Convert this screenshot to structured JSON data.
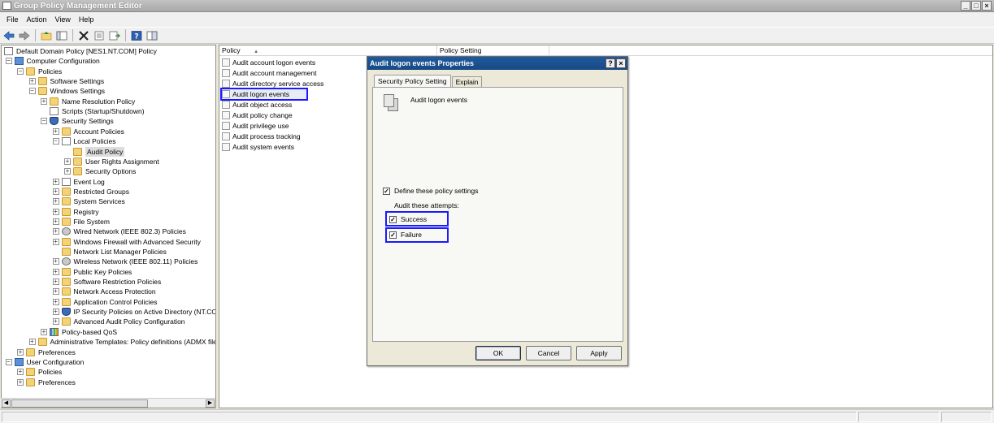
{
  "window": {
    "title": "Group Policy Management Editor",
    "controls": [
      "_",
      "□",
      "×"
    ]
  },
  "menu": [
    "File",
    "Action",
    "View",
    "Help"
  ],
  "tree": [
    {
      "label": "Default Domain Policy [NES1.NT.COM] Policy",
      "icon": "doc-icon",
      "expander": "",
      "indent": 0
    },
    {
      "label": "Computer Configuration",
      "icon": "computer-icon",
      "expander": "−",
      "indent": 1
    },
    {
      "label": "Policies",
      "icon": "folder-icon",
      "expander": "−",
      "indent": 2
    },
    {
      "label": "Software Settings",
      "icon": "folder-icon",
      "expander": "+",
      "indent": 3
    },
    {
      "label": "Windows Settings",
      "icon": "folder-icon",
      "expander": "−",
      "indent": 3
    },
    {
      "label": "Name Resolution Policy",
      "icon": "folder-icon",
      "expander": "+",
      "indent": 4
    },
    {
      "label": "Scripts (Startup/Shutdown)",
      "icon": "doc-icon",
      "expander": "",
      "indent": 4
    },
    {
      "label": "Security Settings",
      "icon": "shield-icon",
      "expander": "−",
      "indent": 4
    },
    {
      "label": "Account Policies",
      "icon": "folder-icon",
      "expander": "+",
      "indent": 5
    },
    {
      "label": "Local Policies",
      "icon": "doc-icon",
      "expander": "−",
      "indent": 5
    },
    {
      "label": "Audit Policy",
      "icon": "folder-icon",
      "expander": "",
      "indent": 6,
      "selected": true
    },
    {
      "label": "User Rights Assignment",
      "icon": "folder-icon",
      "expander": "+",
      "indent": 6
    },
    {
      "label": "Security Options",
      "icon": "folder-icon",
      "expander": "+",
      "indent": 6
    },
    {
      "label": "Event Log",
      "icon": "doc-icon",
      "expander": "+",
      "indent": 5
    },
    {
      "label": "Restricted Groups",
      "icon": "folder-icon",
      "expander": "+",
      "indent": 5
    },
    {
      "label": "System Services",
      "icon": "folder-icon",
      "expander": "+",
      "indent": 5
    },
    {
      "label": "Registry",
      "icon": "folder-icon",
      "expander": "+",
      "indent": 5
    },
    {
      "label": "File System",
      "icon": "folder-icon",
      "expander": "+",
      "indent": 5
    },
    {
      "label": "Wired Network (IEEE 802.3) Policies",
      "icon": "gear-icon",
      "expander": "+",
      "indent": 5
    },
    {
      "label": "Windows Firewall with Advanced Security",
      "icon": "folder-icon",
      "expander": "+",
      "indent": 5
    },
    {
      "label": "Network List Manager Policies",
      "icon": "folder-icon",
      "expander": "",
      "indent": 5
    },
    {
      "label": "Wireless Network (IEEE 802.11) Policies",
      "icon": "gear-icon",
      "expander": "+",
      "indent": 5
    },
    {
      "label": "Public Key Policies",
      "icon": "folder-icon",
      "expander": "+",
      "indent": 5
    },
    {
      "label": "Software Restriction Policies",
      "icon": "folder-icon",
      "expander": "+",
      "indent": 5
    },
    {
      "label": "Network Access Protection",
      "icon": "folder-icon",
      "expander": "+",
      "indent": 5
    },
    {
      "label": "Application Control Policies",
      "icon": "folder-icon",
      "expander": "+",
      "indent": 5
    },
    {
      "label": "IP Security Policies on Active Directory (NT.CO",
      "icon": "shield-icon",
      "expander": "+",
      "indent": 5
    },
    {
      "label": "Advanced Audit Policy Configuration",
      "icon": "folder-icon",
      "expander": "+",
      "indent": 5
    },
    {
      "label": "Policy-based QoS",
      "icon": "chart-icon",
      "expander": "+",
      "indent": 4
    },
    {
      "label": "Administrative Templates: Policy definitions (ADMX files",
      "icon": "folder-icon",
      "expander": "+",
      "indent": 3
    },
    {
      "label": "Preferences",
      "icon": "folder-icon",
      "expander": "+",
      "indent": 2
    },
    {
      "label": "User Configuration",
      "icon": "computer-icon",
      "expander": "−",
      "indent": 1
    },
    {
      "label": "Policies",
      "icon": "folder-icon",
      "expander": "+",
      "indent": 2
    },
    {
      "label": "Preferences",
      "icon": "folder-icon",
      "expander": "+",
      "indent": 2
    }
  ],
  "list": {
    "columns": [
      "Policy",
      "Policy Setting"
    ],
    "sort_indicator": "▲",
    "items": [
      "Audit account logon events",
      "Audit account management",
      "Audit directory service access",
      "Audit logon events",
      "Audit object access",
      "Audit policy change",
      "Audit privilege use",
      "Audit process tracking",
      "Audit system events"
    ],
    "selected_index": 3
  },
  "dialog": {
    "title": "Audit logon events Properties",
    "title_buttons": [
      "?",
      "×"
    ],
    "tabs": [
      "Security Policy Setting",
      "Explain"
    ],
    "active_tab": 0,
    "policy_name": "Audit logon events",
    "define_label": "Define these policy settings",
    "define_checked": true,
    "attempts_label": "Audit these attempts:",
    "success_label": "Success",
    "success_checked": true,
    "failure_label": "Failure",
    "failure_checked": true,
    "ok_label": "OK",
    "cancel_label": "Cancel",
    "apply_label": "Apply"
  },
  "colors": {
    "highlight": "#1a1aff",
    "dialog_title": "#1f5a9e"
  }
}
